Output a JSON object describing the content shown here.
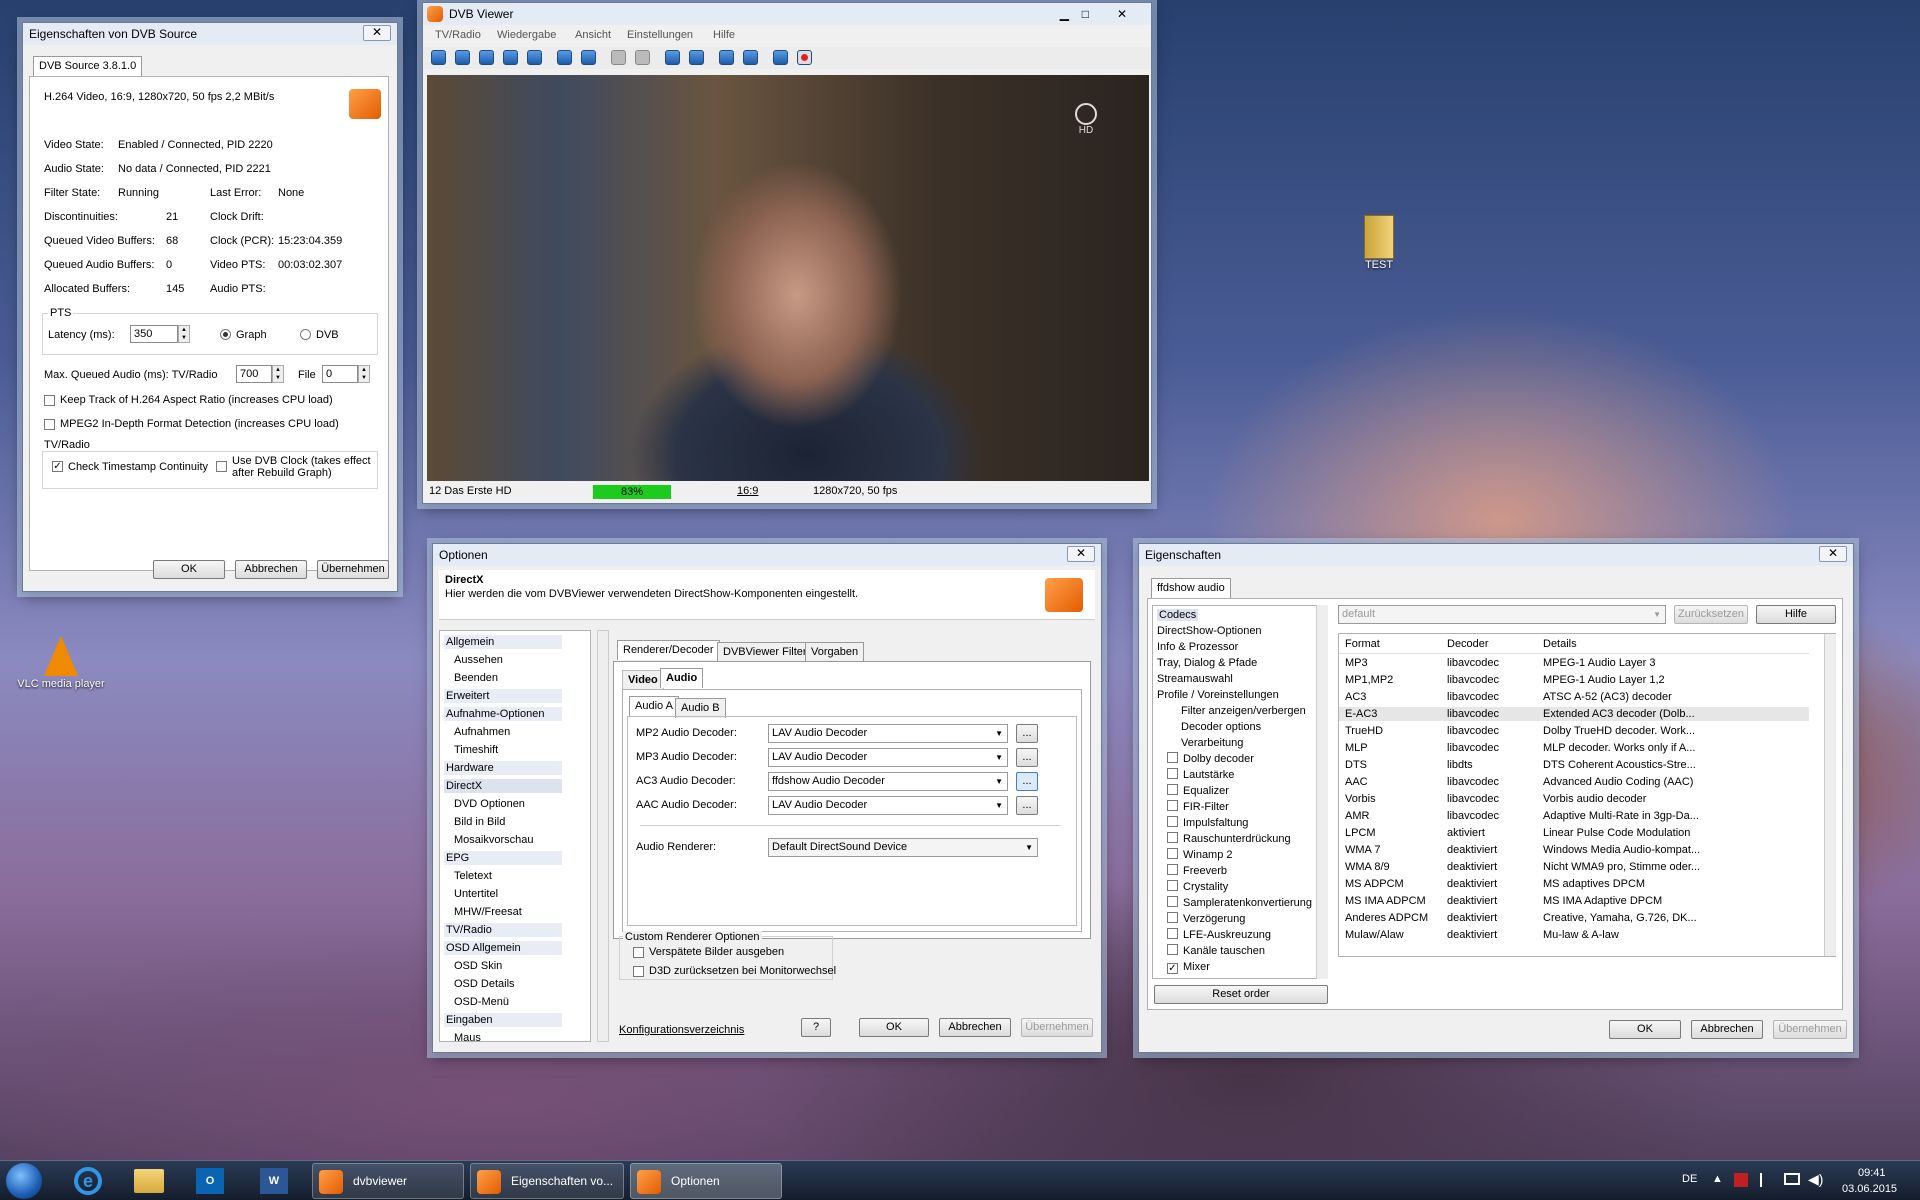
{
  "desktop": {
    "vlc_label": "VLC media player",
    "test_label": "TEST"
  },
  "props_window": {
    "title": "Eigenschaften von DVB Source",
    "tab": "DVB Source 3.8.1.0",
    "video_info": "H.264 Video, 16:9, 1280x720, 50 fps  2,2 MBit/s",
    "video_state_label": "Video State:",
    "video_state": "Enabled / Connected, PID 2220",
    "audio_state_label": "Audio State:",
    "audio_state": "No data / Connected, PID 2221",
    "filter_state_label": "Filter State:",
    "filter_state": "Running",
    "last_error_label": "Last Error:",
    "last_error": "None",
    "disc_label": "Discontinuities:",
    "disc": "21",
    "clock_drift_label": "Clock Drift:",
    "qvb_label": "Queued Video Buffers:",
    "qvb": "68",
    "clock_pcr_label": "Clock (PCR):",
    "clock_pcr": "15:23:04.359",
    "qab_label": "Queued Audio Buffers:",
    "qab": "0",
    "video_pts_label": "Video PTS:",
    "video_pts": "00:03:02.307",
    "alloc_label": "Allocated Buffers:",
    "alloc": "145",
    "audio_pts_label": "Audio PTS:",
    "pts_group": "PTS",
    "latency_label": "Latency (ms):",
    "latency": "350",
    "graph_label": "Graph",
    "dvb_label": "DVB",
    "maxq_label": "Max. Queued Audio (ms): TV/Radio",
    "maxq": "700",
    "file_label": "File",
    "file_val": "0",
    "cb1": "Keep Track of H.264 Aspect Ratio (increases CPU load)",
    "cb2": "MPEG2 In-Depth Format Detection (increases CPU load)",
    "tvradio": "TV/Radio",
    "cb3": "Check Timestamp Continuity",
    "cb4a": "Use DVB Clock (takes effect",
    "cb4b": "after Rebuild Graph)",
    "ok": "OK",
    "cancel": "Abbrechen",
    "apply": "Übernehmen"
  },
  "viewer": {
    "title": "DVB Viewer",
    "menu": [
      "TV/Radio",
      "Wiedergabe",
      "Ansicht",
      "Einstellungen",
      "Hilfe"
    ],
    "channel": "12 Das Erste HD",
    "level": "83%",
    "aspect": "16:9",
    "res": "1280x720, 50 fps",
    "logo": "HD"
  },
  "options": {
    "title": "Optionen",
    "head_title": "DirectX",
    "head_desc": "Hier werden die vom DVBViewer verwendeten DirectShow-Komponenten eingestellt.",
    "nav": [
      {
        "t": "Allgemein",
        "h": true
      },
      {
        "t": "Aussehen"
      },
      {
        "t": "Beenden"
      },
      {
        "t": "Erweitert",
        "h": true
      },
      {
        "t": "Aufnahme-Optionen",
        "h": true
      },
      {
        "t": "Aufnahmen"
      },
      {
        "t": "Timeshift"
      },
      {
        "t": "Hardware",
        "h": true
      },
      {
        "t": "DirectX",
        "h": true,
        "sel": true
      },
      {
        "t": "DVD Optionen"
      },
      {
        "t": "Bild in Bild"
      },
      {
        "t": "Mosaikvorschau"
      },
      {
        "t": "EPG",
        "h": true
      },
      {
        "t": "Teletext"
      },
      {
        "t": "Untertitel"
      },
      {
        "t": "MHW/Freesat"
      },
      {
        "t": "TV/Radio",
        "h": true
      },
      {
        "t": "OSD Allgemein",
        "h": true
      },
      {
        "t": "OSD Skin"
      },
      {
        "t": "OSD Details"
      },
      {
        "t": "OSD-Menü"
      },
      {
        "t": "Eingaben",
        "h": true
      },
      {
        "t": "Maus"
      }
    ],
    "tabs": [
      "Renderer/Decoder",
      "DVBViewer Filter",
      "Vorgaben"
    ],
    "subtabs": [
      "Video",
      "Audio"
    ],
    "subsub": [
      "Audio A",
      "Audio B"
    ],
    "decoders": [
      {
        "label": "MP2 Audio Decoder:",
        "value": "LAV Audio Decoder"
      },
      {
        "label": "MP3 Audio Decoder:",
        "value": "LAV Audio Decoder"
      },
      {
        "label": "AC3 Audio Decoder:",
        "value": "ffdshow Audio Decoder"
      },
      {
        "label": "AAC Audio Decoder:",
        "value": "LAV Audio Decoder"
      }
    ],
    "renderer_label": "Audio Renderer:",
    "renderer": "Default DirectSound Device",
    "custom_group": "Custom Renderer Optionen",
    "cbA": "Verspätete Bilder ausgeben",
    "cbB": "D3D zurücksetzen bei Monitorwechsel",
    "link": "Konfigurationsverzeichnis",
    "help": "?",
    "ok": "OK",
    "cancel": "Abbrechen",
    "apply": "Übernehmen",
    "dots": "..."
  },
  "ffdshow": {
    "title": "Eigenschaften",
    "tab": "ffdshow audio",
    "preset": "default",
    "reset": "Zurücksetzen",
    "help": "Hilfe",
    "tree": [
      {
        "t": "Codecs",
        "lvl": 0,
        "sel": true
      },
      {
        "t": "DirectShow-Optionen",
        "lvl": 0
      },
      {
        "t": "Info & Prozessor",
        "lvl": 0
      },
      {
        "t": "Tray, Dialog & Pfade",
        "lvl": 0
      },
      {
        "t": "Streamauswahl",
        "lvl": 0
      },
      {
        "t": "Profile / Voreinstellungen",
        "lvl": 0
      },
      {
        "t": "Filter anzeigen/verbergen",
        "lvl": 2
      },
      {
        "t": "Decoder options",
        "lvl": 2
      },
      {
        "t": "Verarbeitung",
        "lvl": 2
      },
      {
        "t": "Dolby decoder",
        "cb": false
      },
      {
        "t": "Lautstärke",
        "cb": false
      },
      {
        "t": "Equalizer",
        "cb": false
      },
      {
        "t": "FIR-Filter",
        "cb": false
      },
      {
        "t": "Impulsfaltung",
        "cb": false
      },
      {
        "t": "Rauschunterdrückung",
        "cb": false
      },
      {
        "t": "Winamp 2",
        "cb": false
      },
      {
        "t": "Freeverb",
        "cb": false
      },
      {
        "t": "Crystality",
        "cb": false
      },
      {
        "t": "Sampleratenkonvertierung",
        "cb": false
      },
      {
        "t": "Verzögerung",
        "cb": false
      },
      {
        "t": "LFE-Auskreuzung",
        "cb": false
      },
      {
        "t": "Kanäle tauschen",
        "cb": false
      },
      {
        "t": "Mixer",
        "cb": true
      }
    ],
    "reset_order": "Reset order",
    "columns": [
      "Format",
      "Decoder",
      "Details"
    ],
    "rows": [
      [
        "MP3",
        "libavcodec",
        "MPEG-1 Audio Layer 3"
      ],
      [
        "MP1,MP2",
        "libavcodec",
        "MPEG-1 Audio Layer 1,2"
      ],
      [
        "AC3",
        "libavcodec",
        "ATSC A-52 (AC3) decoder"
      ],
      [
        "E-AC3",
        "libavcodec",
        "Extended AC3 decoder (Dolb..."
      ],
      [
        "TrueHD",
        "libavcodec",
        "Dolby TrueHD decoder. Work..."
      ],
      [
        "MLP",
        "libavcodec",
        "MLP decoder. Works only if A..."
      ],
      [
        "DTS",
        "libdts",
        "DTS Coherent Acoustics-Stre..."
      ],
      [
        "AAC",
        "libavcodec",
        "Advanced Audio Coding (AAC)"
      ],
      [
        "Vorbis",
        "libavcodec",
        "Vorbis audio decoder"
      ],
      [
        "AMR",
        "libavcodec",
        "Adaptive Multi-Rate in 3gp-Da..."
      ],
      [
        "LPCM",
        "aktiviert",
        "Linear Pulse Code Modulation"
      ],
      [
        "WMA 7",
        "deaktiviert",
        "Windows Media Audio-kompat..."
      ],
      [
        "WMA 8/9",
        "deaktiviert",
        "Nicht WMA9 pro, Stimme oder..."
      ],
      [
        "MS ADPCM",
        "deaktiviert",
        "MS adaptives DPCM"
      ],
      [
        "MS IMA ADPCM",
        "deaktiviert",
        "MS IMA Adaptive DPCM"
      ],
      [
        "Anderes ADPCM",
        "deaktiviert",
        "Creative, Yamaha, G.726, DK..."
      ],
      [
        "Mulaw/Alaw",
        "deaktiviert",
        "Mu-law & A-law"
      ]
    ],
    "ok": "OK",
    "cancel": "Abbrechen",
    "apply": "Übernehmen"
  },
  "taskbar": {
    "items": [
      "dvbviewer",
      "Eigenschaften vo...",
      "Optionen"
    ],
    "lang": "DE",
    "time": "09:41",
    "date": "03.06.2015"
  }
}
